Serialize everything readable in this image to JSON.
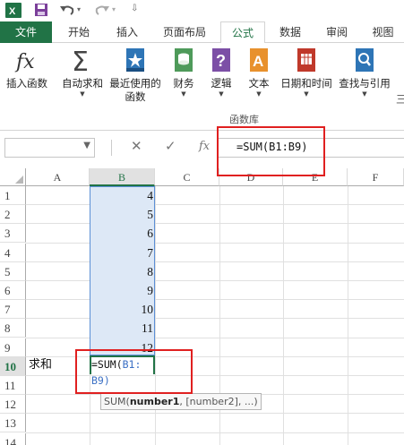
{
  "quick_access": {
    "icons": [
      "excel-icon",
      "save-icon",
      "undo-icon",
      "redo-icon",
      "customize-qat-icon"
    ]
  },
  "tabs": [
    {
      "label": "文件"
    },
    {
      "label": "开始"
    },
    {
      "label": "插入"
    },
    {
      "label": "页面布局"
    },
    {
      "label": "公式"
    },
    {
      "label": "数据"
    },
    {
      "label": "审阅"
    },
    {
      "label": "视图"
    }
  ],
  "ribbon": {
    "buttons": [
      {
        "label": "插入函数",
        "label2": "",
        "icon": "fx-icon"
      },
      {
        "label": "自动求和",
        "label2": "",
        "icon": "sigma-icon"
      },
      {
        "label": "最近使用的",
        "label2": "函数",
        "icon": "star-book-icon"
      },
      {
        "label": "财务",
        "label2": "",
        "icon": "coins-book-icon"
      },
      {
        "label": "逻辑",
        "label2": "",
        "icon": "question-book-icon"
      },
      {
        "label": "文本",
        "label2": "",
        "icon": "text-book-icon"
      },
      {
        "label": "日期和时间",
        "label2": "",
        "icon": "calendar-book-icon"
      },
      {
        "label": "查找与引用",
        "label2": "",
        "icon": "search-book-icon"
      }
    ],
    "group_label": "函数库",
    "colors": {
      "accent": "#217346",
      "book_blue": "#2e75b6",
      "book_green": "#4e9a5a",
      "book_purple": "#7c4fa6",
      "book_orange": "#e8912d",
      "book_red": "#c0392b"
    }
  },
  "formula_bar": {
    "name_box_value": "",
    "cancel": "✕",
    "enter": "✓",
    "fx": "fx",
    "formula": "=SUM(B1:B9)"
  },
  "sheet": {
    "columns": [
      "A",
      "B",
      "C",
      "D",
      "E",
      "F"
    ],
    "selected_column": "B",
    "rows": [
      "1",
      "2",
      "3",
      "4",
      "5",
      "6",
      "7",
      "8",
      "9",
      "10",
      "11",
      "12",
      "13",
      "14"
    ],
    "b_values": [
      "4",
      "5",
      "6",
      "7",
      "8",
      "9",
      "10",
      "11",
      "12"
    ],
    "a10_label": "求和",
    "edit_line1": "=SUM(",
    "edit_line1_ref": "B1:",
    "edit_line2": "B9)",
    "tooltip_func": "SUM(",
    "tooltip_arg1": "number1",
    "tooltip_rest": ", [number2], ...)"
  }
}
